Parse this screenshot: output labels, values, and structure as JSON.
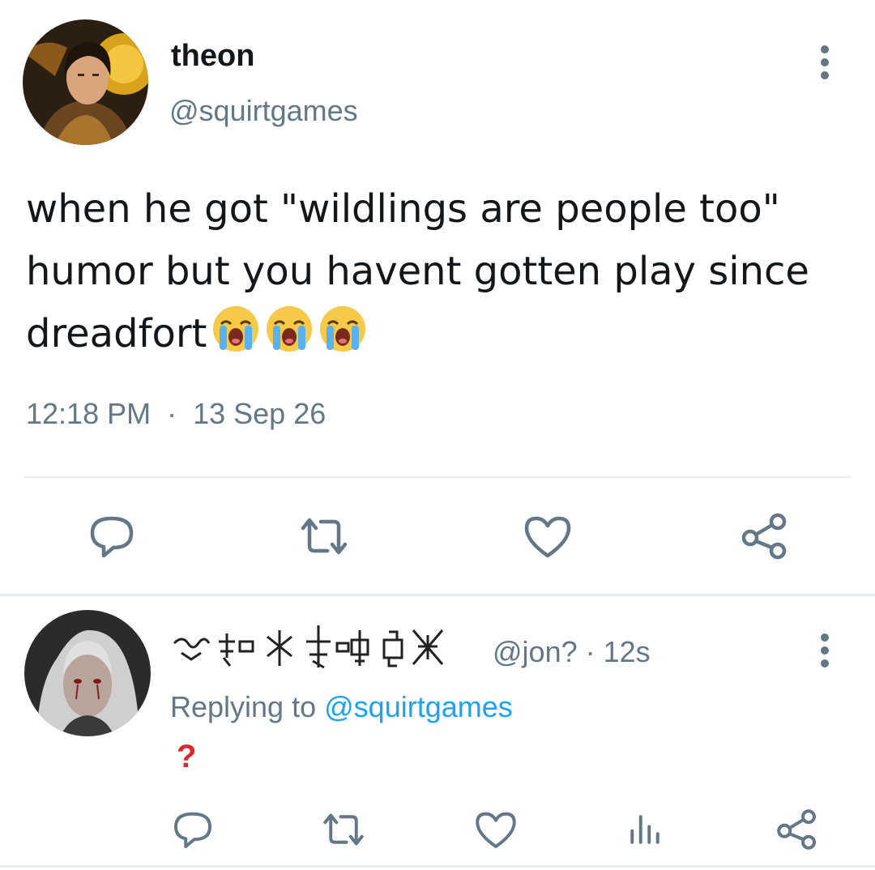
{
  "tweet": {
    "display_name": "theon",
    "handle": "@squirtgames",
    "text": "when he got \"wildlings are people too\" humor but you havent gotten play since dreadfort",
    "emoji_count": 3,
    "time": "12:18 PM",
    "separator": "·",
    "date": "13 Sep 26"
  },
  "actions": {
    "main": [
      "reply-icon",
      "retweet-icon",
      "like-icon",
      "share-icon"
    ],
    "reply": [
      "reply-icon",
      "retweet-icon",
      "like-icon",
      "analytics-icon",
      "share-icon"
    ]
  },
  "reply": {
    "display_name_note": "decorative symbol glyphs",
    "handle": "@jon?",
    "time": "12s",
    "meta": "@jon? · 12s",
    "replying_prefix": "Replying to",
    "replying_handle": "@squirtgames",
    "text": "?"
  },
  "colors": {
    "text": "#14171a",
    "secondary": "#657786",
    "link": "#1da1f2",
    "divider": "#e6ecf0",
    "question_mark": "#e0262b"
  }
}
